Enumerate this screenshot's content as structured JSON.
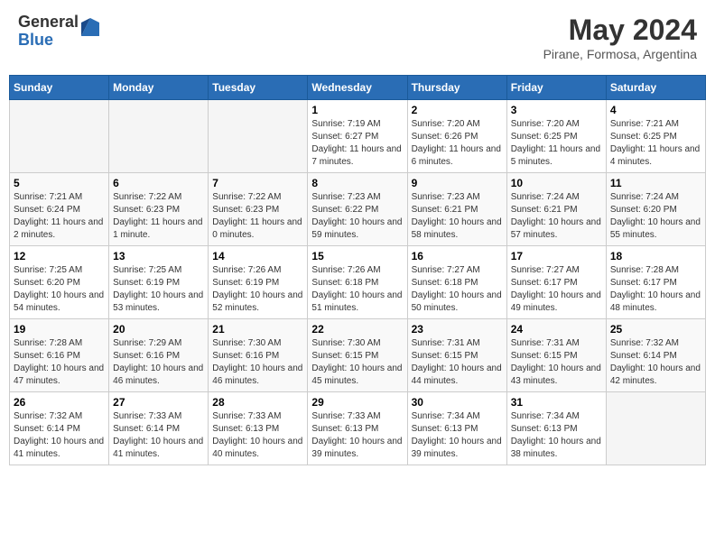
{
  "header": {
    "logo_general": "General",
    "logo_blue": "Blue",
    "title": "May 2024",
    "subtitle": "Pirane, Formosa, Argentina"
  },
  "days_of_week": [
    "Sunday",
    "Monday",
    "Tuesday",
    "Wednesday",
    "Thursday",
    "Friday",
    "Saturday"
  ],
  "weeks": [
    [
      {
        "day": "",
        "info": ""
      },
      {
        "day": "",
        "info": ""
      },
      {
        "day": "",
        "info": ""
      },
      {
        "day": "1",
        "info": "Sunrise: 7:19 AM\nSunset: 6:27 PM\nDaylight: 11 hours and 7 minutes."
      },
      {
        "day": "2",
        "info": "Sunrise: 7:20 AM\nSunset: 6:26 PM\nDaylight: 11 hours and 6 minutes."
      },
      {
        "day": "3",
        "info": "Sunrise: 7:20 AM\nSunset: 6:25 PM\nDaylight: 11 hours and 5 minutes."
      },
      {
        "day": "4",
        "info": "Sunrise: 7:21 AM\nSunset: 6:25 PM\nDaylight: 11 hours and 4 minutes."
      }
    ],
    [
      {
        "day": "5",
        "info": "Sunrise: 7:21 AM\nSunset: 6:24 PM\nDaylight: 11 hours and 2 minutes."
      },
      {
        "day": "6",
        "info": "Sunrise: 7:22 AM\nSunset: 6:23 PM\nDaylight: 11 hours and 1 minute."
      },
      {
        "day": "7",
        "info": "Sunrise: 7:22 AM\nSunset: 6:23 PM\nDaylight: 11 hours and 0 minutes."
      },
      {
        "day": "8",
        "info": "Sunrise: 7:23 AM\nSunset: 6:22 PM\nDaylight: 10 hours and 59 minutes."
      },
      {
        "day": "9",
        "info": "Sunrise: 7:23 AM\nSunset: 6:21 PM\nDaylight: 10 hours and 58 minutes."
      },
      {
        "day": "10",
        "info": "Sunrise: 7:24 AM\nSunset: 6:21 PM\nDaylight: 10 hours and 57 minutes."
      },
      {
        "day": "11",
        "info": "Sunrise: 7:24 AM\nSunset: 6:20 PM\nDaylight: 10 hours and 55 minutes."
      }
    ],
    [
      {
        "day": "12",
        "info": "Sunrise: 7:25 AM\nSunset: 6:20 PM\nDaylight: 10 hours and 54 minutes."
      },
      {
        "day": "13",
        "info": "Sunrise: 7:25 AM\nSunset: 6:19 PM\nDaylight: 10 hours and 53 minutes."
      },
      {
        "day": "14",
        "info": "Sunrise: 7:26 AM\nSunset: 6:19 PM\nDaylight: 10 hours and 52 minutes."
      },
      {
        "day": "15",
        "info": "Sunrise: 7:26 AM\nSunset: 6:18 PM\nDaylight: 10 hours and 51 minutes."
      },
      {
        "day": "16",
        "info": "Sunrise: 7:27 AM\nSunset: 6:18 PM\nDaylight: 10 hours and 50 minutes."
      },
      {
        "day": "17",
        "info": "Sunrise: 7:27 AM\nSunset: 6:17 PM\nDaylight: 10 hours and 49 minutes."
      },
      {
        "day": "18",
        "info": "Sunrise: 7:28 AM\nSunset: 6:17 PM\nDaylight: 10 hours and 48 minutes."
      }
    ],
    [
      {
        "day": "19",
        "info": "Sunrise: 7:28 AM\nSunset: 6:16 PM\nDaylight: 10 hours and 47 minutes."
      },
      {
        "day": "20",
        "info": "Sunrise: 7:29 AM\nSunset: 6:16 PM\nDaylight: 10 hours and 46 minutes."
      },
      {
        "day": "21",
        "info": "Sunrise: 7:30 AM\nSunset: 6:16 PM\nDaylight: 10 hours and 46 minutes."
      },
      {
        "day": "22",
        "info": "Sunrise: 7:30 AM\nSunset: 6:15 PM\nDaylight: 10 hours and 45 minutes."
      },
      {
        "day": "23",
        "info": "Sunrise: 7:31 AM\nSunset: 6:15 PM\nDaylight: 10 hours and 44 minutes."
      },
      {
        "day": "24",
        "info": "Sunrise: 7:31 AM\nSunset: 6:15 PM\nDaylight: 10 hours and 43 minutes."
      },
      {
        "day": "25",
        "info": "Sunrise: 7:32 AM\nSunset: 6:14 PM\nDaylight: 10 hours and 42 minutes."
      }
    ],
    [
      {
        "day": "26",
        "info": "Sunrise: 7:32 AM\nSunset: 6:14 PM\nDaylight: 10 hours and 41 minutes."
      },
      {
        "day": "27",
        "info": "Sunrise: 7:33 AM\nSunset: 6:14 PM\nDaylight: 10 hours and 41 minutes."
      },
      {
        "day": "28",
        "info": "Sunrise: 7:33 AM\nSunset: 6:13 PM\nDaylight: 10 hours and 40 minutes."
      },
      {
        "day": "29",
        "info": "Sunrise: 7:33 AM\nSunset: 6:13 PM\nDaylight: 10 hours and 39 minutes."
      },
      {
        "day": "30",
        "info": "Sunrise: 7:34 AM\nSunset: 6:13 PM\nDaylight: 10 hours and 39 minutes."
      },
      {
        "day": "31",
        "info": "Sunrise: 7:34 AM\nSunset: 6:13 PM\nDaylight: 10 hours and 38 minutes."
      },
      {
        "day": "",
        "info": ""
      }
    ]
  ]
}
